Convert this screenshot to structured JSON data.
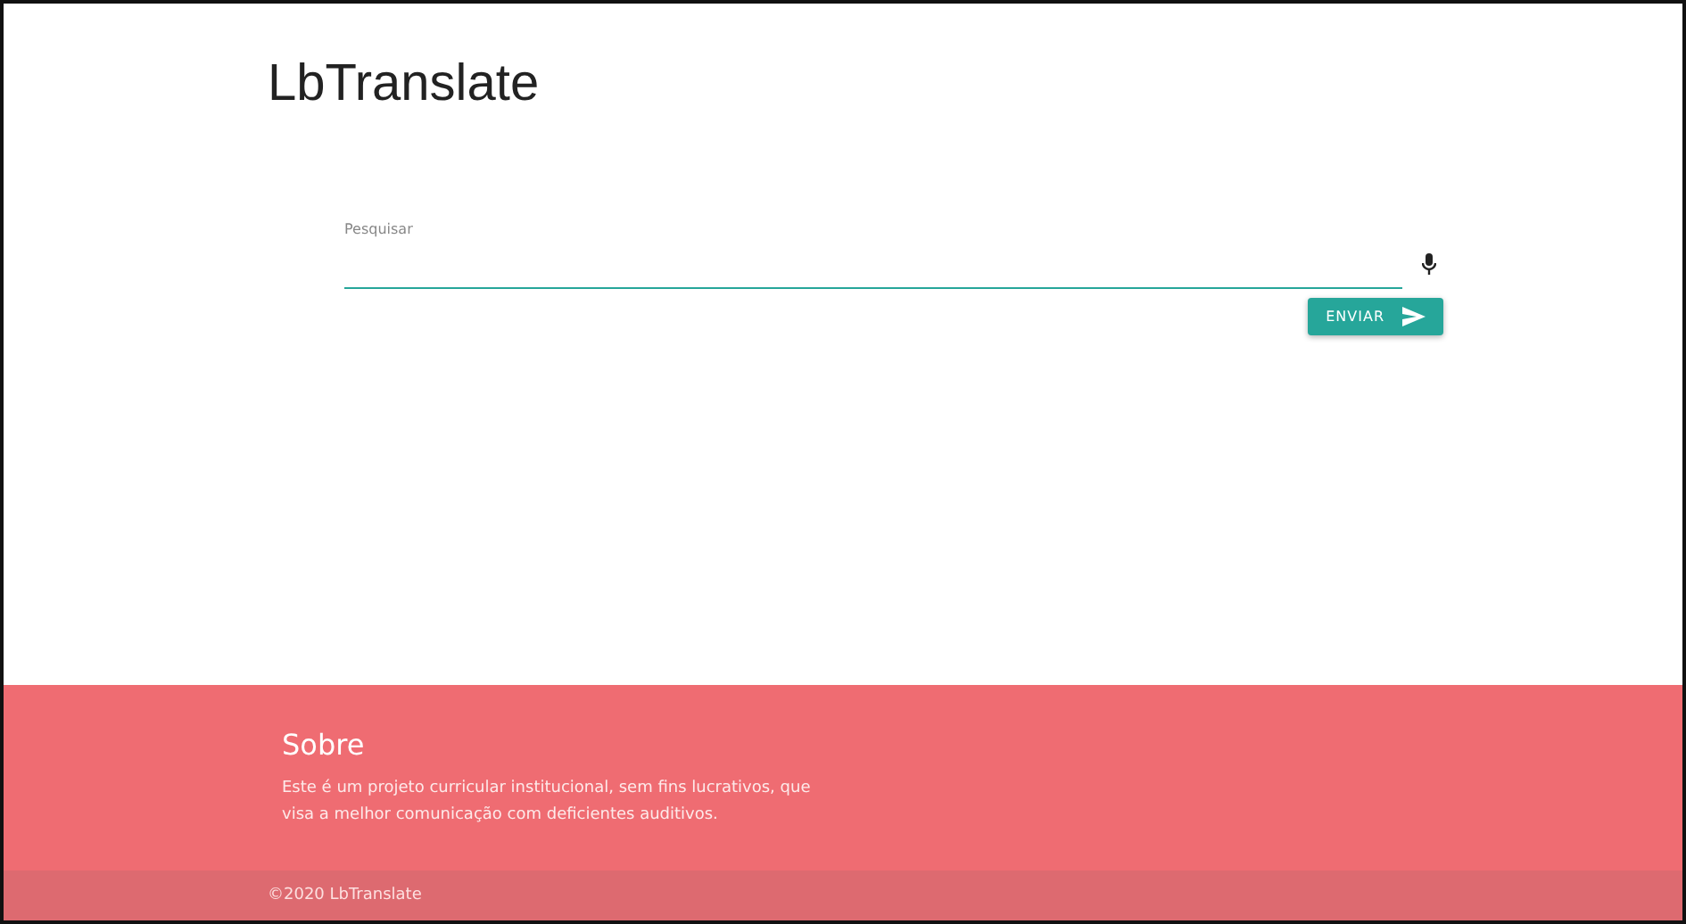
{
  "header": {
    "title": "LbTranslate"
  },
  "search": {
    "label": "Pesquisar",
    "button": "ENVIAR"
  },
  "footer": {
    "heading": "Sobre",
    "text": "Este é um projeto curricular institucional, sem fins lucrativos, que visa a melhor comunicação com deficientes auditivos.",
    "copyright": "©2020 LbTranslate"
  }
}
